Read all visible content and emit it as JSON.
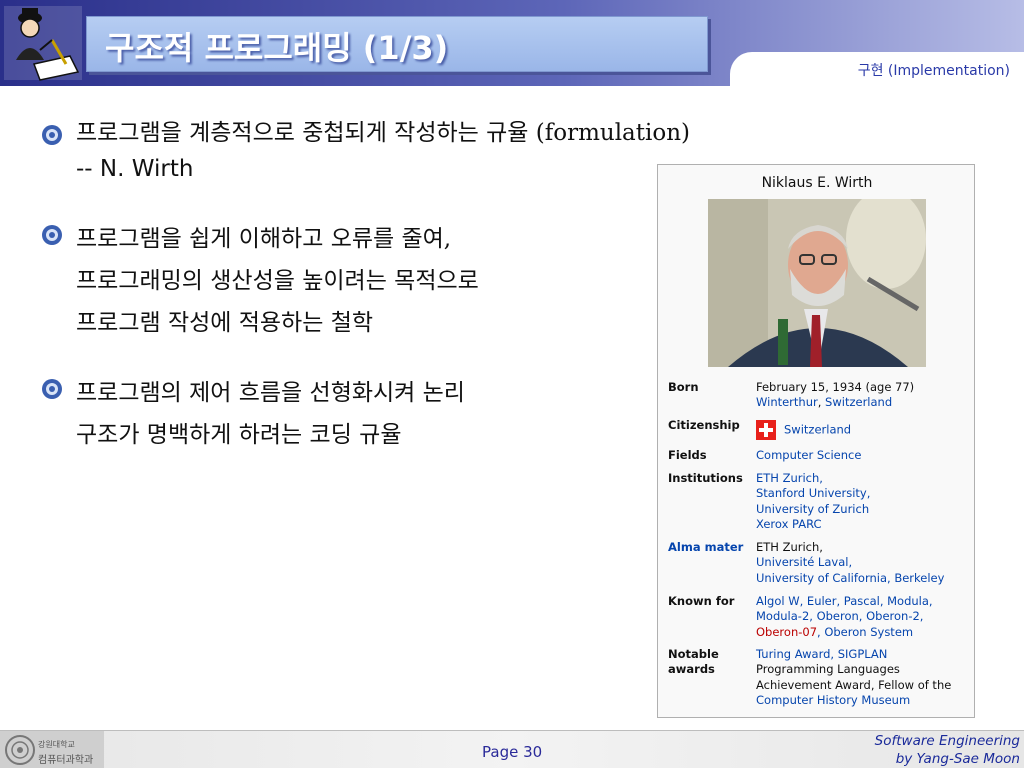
{
  "header": {
    "title": "구조적 프로그래밍 (1/3)",
    "section": "구현 (Implementation)"
  },
  "bullets": [
    {
      "lines": [
        "프로그램을 계층적으로 중첩되게 작성하는 규율 (formulation)",
        "-- N. Wirth"
      ]
    },
    {
      "lines": [
        "프로그램을 쉽게 이해하고 오류를 줄여,",
        "프로그래밍의 생산성을 높이려는 목적으로",
        "프로그램 작성에 적용하는 철학"
      ]
    },
    {
      "lines": [
        "프로그램의 제어 흐름을 선형화시켜 논리",
        "구조가 명백하게 하려는 코딩 규율"
      ]
    }
  ],
  "infobox": {
    "name": "Niklaus E. Wirth",
    "born": {
      "label": "Born",
      "line1": "February 15, 1934 (age 77)",
      "place1": "Winterthur",
      "sep": ", ",
      "place2": "Switzerland"
    },
    "citizenship": {
      "label": "Citizenship",
      "value": "Switzerland"
    },
    "fields": {
      "label": "Fields",
      "value": "Computer Science"
    },
    "institutions": {
      "label": "Institutions",
      "items": [
        "ETH Zurich,",
        "Stanford University,",
        "University of Zurich",
        "Xerox PARC"
      ]
    },
    "alma_mater": {
      "label": "Alma mater",
      "items": [
        "ETH Zurich,",
        "Université Laval,",
        "University of California, Berkeley"
      ]
    },
    "known_for": {
      "label": "Known for",
      "line1": "Algol W, Euler, Pascal, Modula,",
      "line2": "Modula-2, Oberon, Oberon-2,",
      "line3a": "Oberon-07",
      "line3b": ", Oberon System"
    },
    "awards": {
      "label_line1": "Notable",
      "label_line2": "awards",
      "line1": "Turing Award, SIGPLAN",
      "line2": "Programming Languages",
      "line3": "Achievement Award, Fellow of the",
      "line4": "Computer History Museum"
    }
  },
  "footer": {
    "logo_line1": "강원대학교",
    "logo_line2": "컴퓨터과학과",
    "page": "Page 30",
    "credit_line1": "Software Engineering",
    "credit_line2": "by Yang-Sae Moon"
  },
  "colors": {
    "header_dark": "#2a2f8a",
    "title_box": "#9ab6e8",
    "link": "#0645ad",
    "footer_text": "#1a2a9a"
  }
}
